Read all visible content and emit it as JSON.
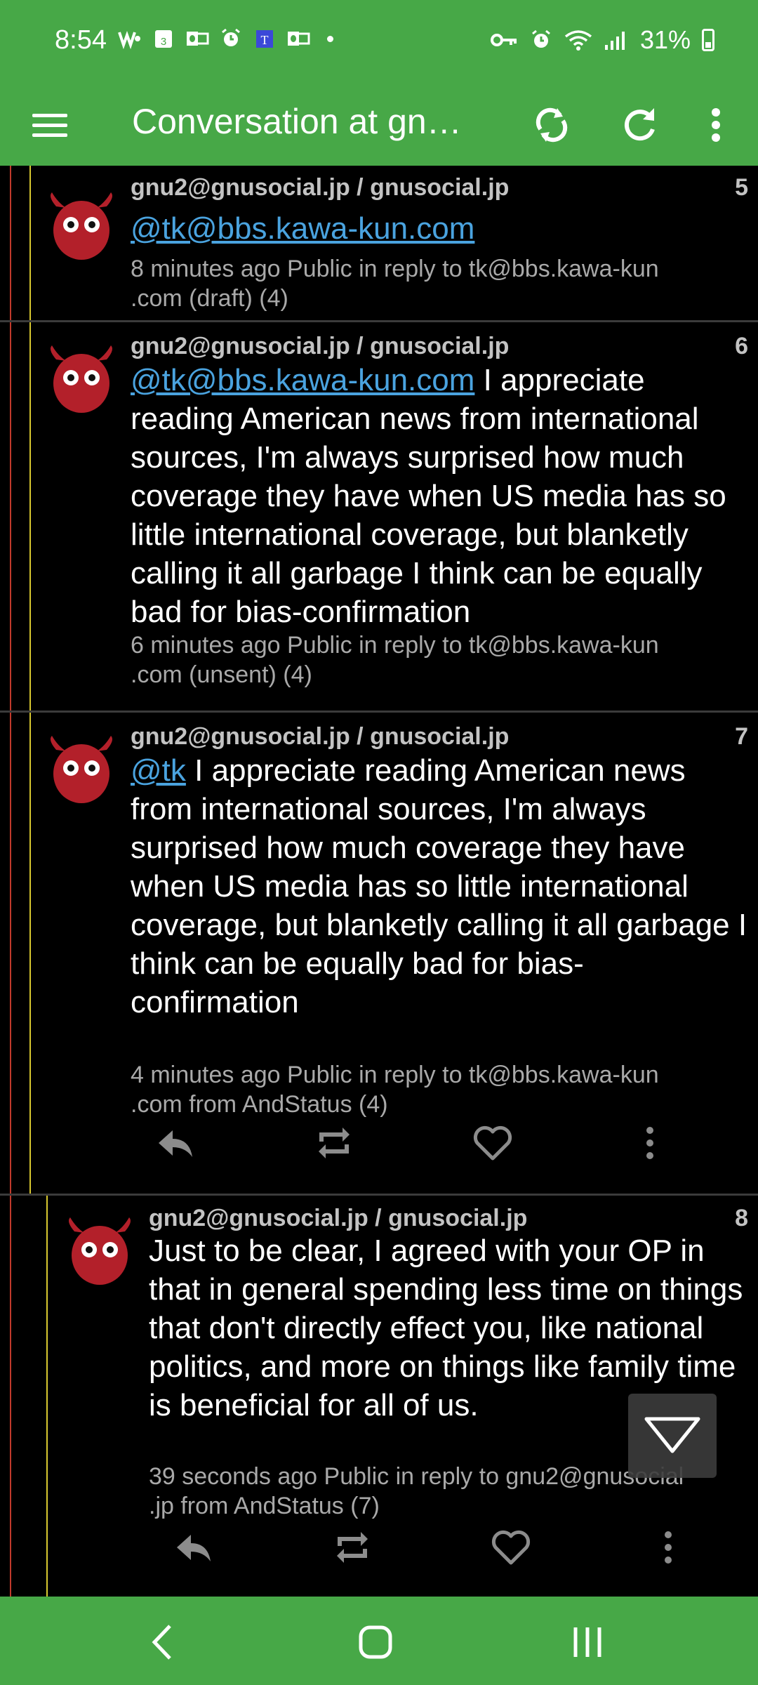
{
  "status_bar": {
    "time": "8:54",
    "battery": "31%",
    "left_icons": [
      "webtoon-icon",
      "calendar-icon",
      "outlook-icon",
      "alarm-icon",
      "teams-icon",
      "outlook-icon"
    ],
    "right_icons": [
      "vpn-key-icon",
      "alarm-icon",
      "wifi-icon",
      "signal-icon",
      "battery-icon"
    ]
  },
  "app_bar": {
    "title": "Conversation at gn…",
    "buttons": [
      "menu-icon",
      "sync-icon",
      "refresh-icon",
      "more-vert-icon"
    ]
  },
  "colors": {
    "brand_green": "#47a847",
    "link": "#4aa3df",
    "thread_line_red": "#c0392b",
    "thread_line_yellow": "#d8c830"
  },
  "messages": [
    {
      "author": "gnu2@gnusocial.jp / gnusocial.jp",
      "number": "5",
      "mention": "@tk@bbs.kawa-kun.com",
      "text": "",
      "meta_line1": "8 minutes ago Public in reply to tk@bbs.kawa-kun",
      "meta_line2": ".com (draft) (4)"
    },
    {
      "author": "gnu2@gnusocial.jp / gnusocial.jp",
      "number": "6",
      "mention": "@tk@bbs.kawa-kun.com",
      "text": " I appreciate reading American news from international sources, I'm always surprised how much coverage they have when US media has so little international coverage, but blanketly calling it all garbage I think can be equally bad for bias-confirmation",
      "meta_line1": "6 minutes ago Public in reply to tk@bbs.kawa-kun",
      "meta_line2": ".com (unsent) (4)"
    },
    {
      "author": "gnu2@gnusocial.jp / gnusocial.jp",
      "number": "7",
      "mention": "@tk",
      "text": " I appreciate reading American news from international sources, I'm always surprised how much coverage they have when US media has so little international coverage, but blanketly calling it all garbage I think can be equally bad for bias-confirmation",
      "meta_line1": "4 minutes ago Public in reply to tk@bbs.kawa-kun",
      "meta_line2": ".com from AndStatus (4)"
    },
    {
      "author": "gnu2@gnusocial.jp / gnusocial.jp",
      "number": "8",
      "mention": "",
      "text": "Just to be clear, I agreed with your OP in that in general spending less time on things that don't directly effect you, like national politics, and more on things like family time is beneficial for all of us.",
      "meta_line1": "39 seconds ago Public in reply to gnu2@gnusocial",
      "meta_line2": ".jp from AndStatus (7)"
    }
  ],
  "action_icons": [
    "reply-icon",
    "reblog-icon",
    "favorite-icon",
    "more-vert-icon"
  ],
  "nav_bar": [
    "back-icon",
    "home-icon",
    "recents-icon"
  ]
}
